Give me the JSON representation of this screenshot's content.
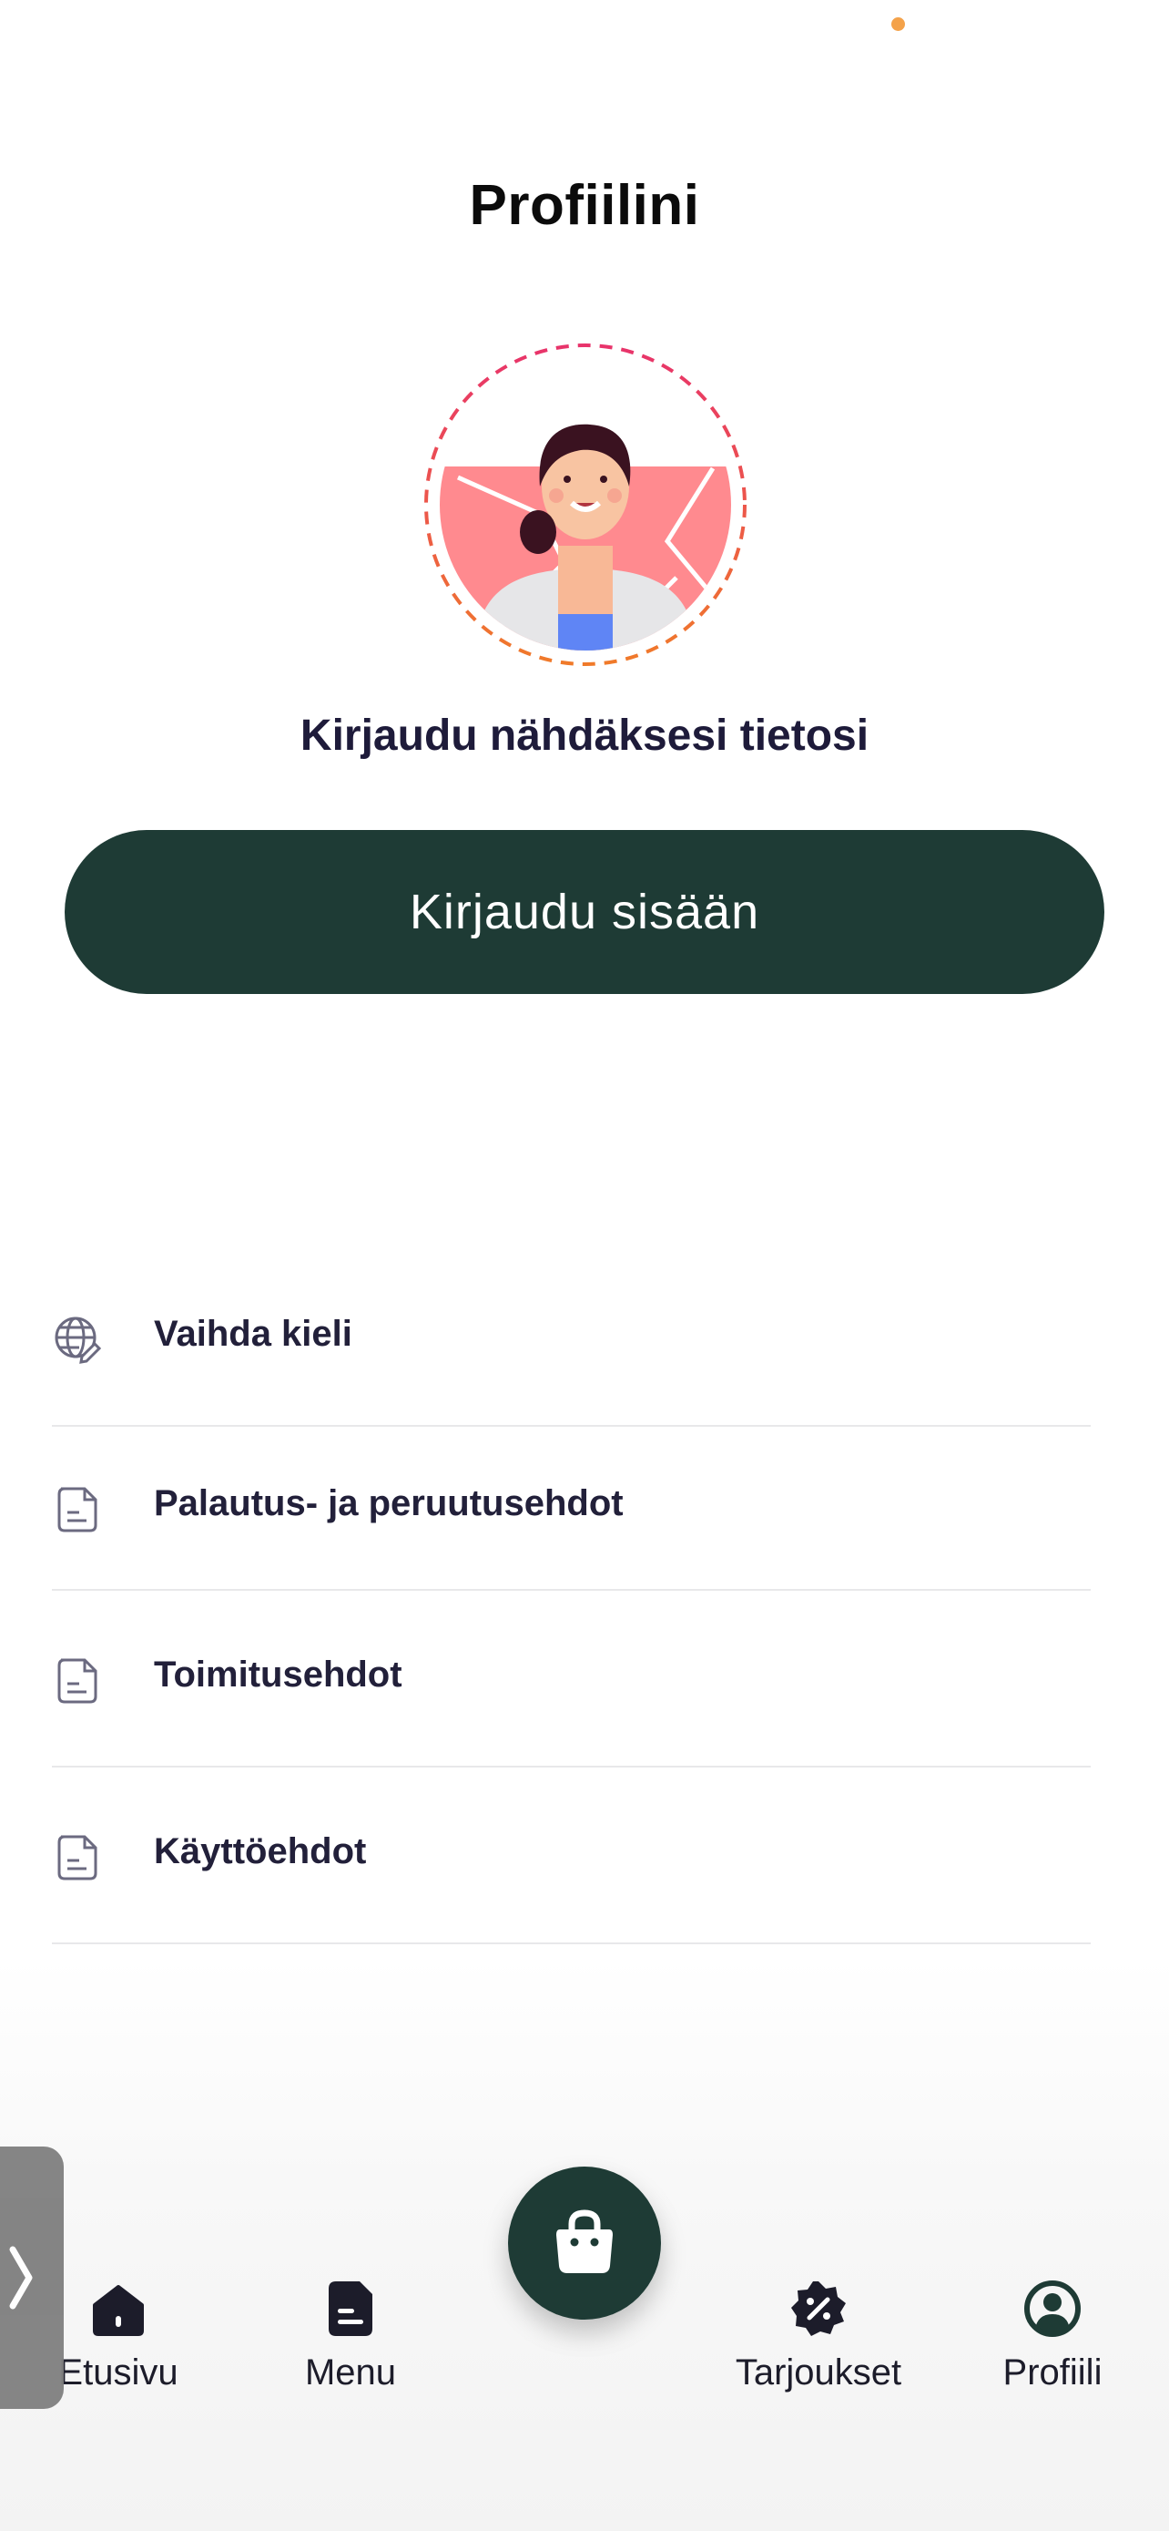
{
  "header": {
    "title": "Profiilini"
  },
  "profile": {
    "prompt": "Kirjaudu nähdäksesi tietosi",
    "login_label": "Kirjaudu sisään"
  },
  "menu": {
    "items": [
      {
        "label": "Vaihda kieli",
        "icon": "globe-edit-icon"
      },
      {
        "label": "Palautus- ja peruutusehdot",
        "icon": "document-icon"
      },
      {
        "label": "Toimitusehdot",
        "icon": "document-icon"
      },
      {
        "label": "Käyttöehdot",
        "icon": "document-icon"
      }
    ]
  },
  "tabbar": {
    "items": [
      {
        "label": "Etusivu",
        "icon": "home-icon",
        "active": false
      },
      {
        "label": "Menu",
        "icon": "menu-document-icon",
        "active": false
      },
      {
        "label": "Tarjoukset",
        "icon": "discount-badge-icon",
        "active": false
      },
      {
        "label": "Profiili",
        "icon": "profile-icon",
        "active": true
      }
    ],
    "center_button_icon": "shopping-bag-icon"
  },
  "colors": {
    "primary": "#1e3b35",
    "text": "#1f1d36",
    "accent_pink": "#ff8a8f",
    "status_dot": "#f4a24a",
    "divider": "#e8e8ea"
  }
}
